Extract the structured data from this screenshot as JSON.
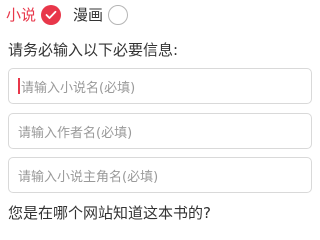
{
  "type_selector": {
    "options": [
      {
        "label": "小说",
        "selected": true,
        "icon": "check-icon"
      },
      {
        "label": "漫画",
        "selected": false,
        "icon": "radio-empty-icon"
      }
    ]
  },
  "form": {
    "required_title": "请务必输入以下必要信息:",
    "fields": [
      {
        "placeholder": "请输入小说名(必填)",
        "value": "",
        "focused": true
      },
      {
        "placeholder": "请输入作者名(必填)",
        "value": "",
        "focused": false
      },
      {
        "placeholder": "请输入小说主角名(必填)",
        "value": "",
        "focused": false
      }
    ],
    "source_question": "您是在哪个网站知道这本书的?"
  },
  "colors": {
    "accent": "#e8374a",
    "border": "#d9d9d9",
    "placeholder": "#9a9a9a",
    "text": "#333333"
  }
}
